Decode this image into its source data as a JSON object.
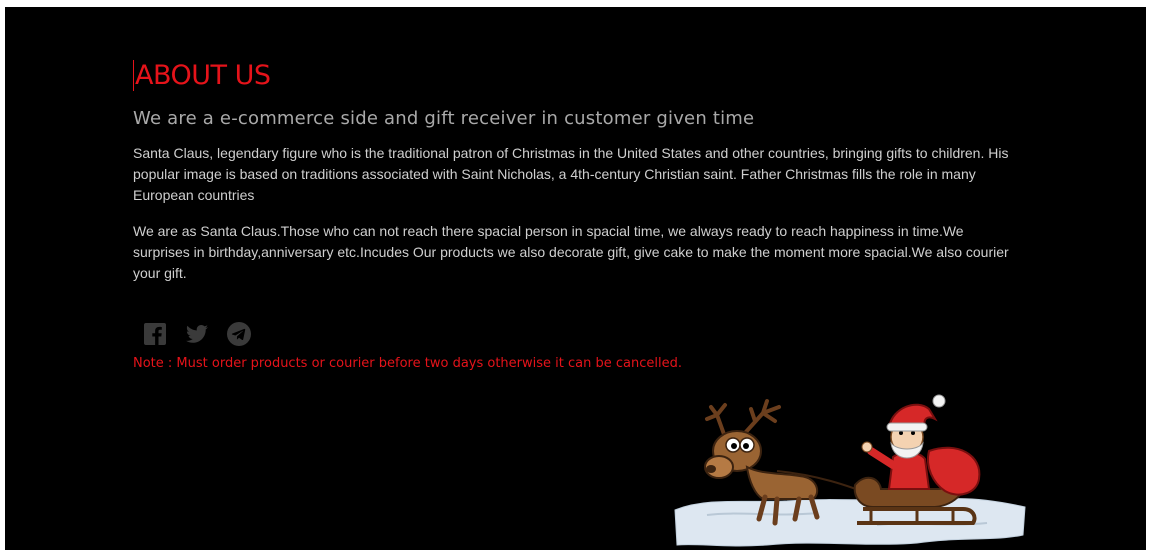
{
  "about": {
    "title": "ABOUT US",
    "subtitle": "We are a e-commerce side and gift receiver in customer given time",
    "paragraph1": "Santa Claus, legendary figure who is the traditional patron of Christmas in the United States and other countries, bringing gifts to children. His popular image is based on traditions associated with Saint Nicholas, a 4th-century Christian saint. Father Christmas fills the role in many European countries",
    "paragraph2": "We are as Santa Claus.Those who can not reach there spacial person in spacial time, we always ready to reach happiness in time.We surprises in birthday,anniversary etc.Incudes Our products we also decorate gift, give cake to make the moment more spacial.We also courier your gift.",
    "note": "Note : Must order products or courier before two days otherwise it can be cancelled."
  },
  "social": {
    "icons": [
      "facebook-icon",
      "twitter-icon",
      "telegram-icon"
    ],
    "icon_color": "#3a3a3a"
  },
  "illustration": {
    "subject": "santa-sleigh-reindeer"
  },
  "colors": {
    "background": "#000000",
    "accent": "#e5131a",
    "subtitle": "#a9a9a9",
    "body_text": "#cfcfcf"
  }
}
